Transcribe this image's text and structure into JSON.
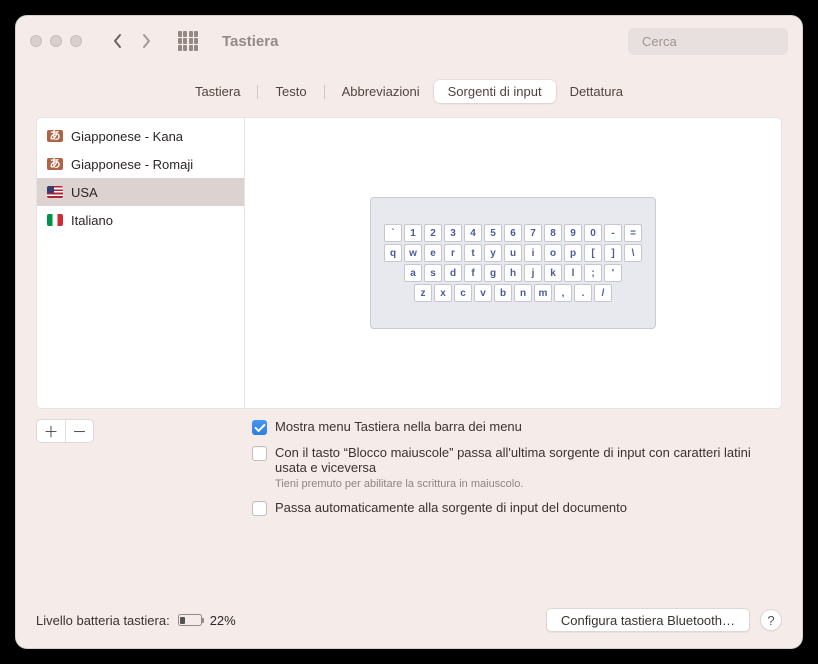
{
  "window": {
    "title": "Tastiera"
  },
  "search": {
    "placeholder": "Cerca"
  },
  "tabs": [
    {
      "label": "Tastiera",
      "selected": false
    },
    {
      "label": "Testo",
      "selected": false
    },
    {
      "label": "Abbreviazioni",
      "selected": false
    },
    {
      "label": "Sorgenti di input",
      "selected": true
    },
    {
      "label": "Dettatura",
      "selected": false
    }
  ],
  "sources": [
    {
      "label": "Giapponese - Kana",
      "flag": "jp",
      "jp_char": "あ",
      "selected": false
    },
    {
      "label": "Giapponese - Romaji",
      "flag": "jp",
      "jp_char": "あ",
      "selected": false
    },
    {
      "label": "USA",
      "flag": "us",
      "selected": true
    },
    {
      "label": "Italiano",
      "flag": "it",
      "selected": false
    }
  ],
  "keyboard_rows": [
    [
      "`",
      "1",
      "2",
      "3",
      "4",
      "5",
      "6",
      "7",
      "8",
      "9",
      "0",
      "-",
      "="
    ],
    [
      "q",
      "w",
      "e",
      "r",
      "t",
      "y",
      "u",
      "i",
      "o",
      "p",
      "[",
      "]",
      "\\"
    ],
    [
      "a",
      "s",
      "d",
      "f",
      "g",
      "h",
      "j",
      "k",
      "l",
      ";",
      "'"
    ],
    [
      "z",
      "x",
      "c",
      "v",
      "b",
      "n",
      "m",
      ",",
      ".",
      "/"
    ]
  ],
  "options": {
    "show_menu": {
      "checked": true,
      "label": "Mostra menu Tastiera nella barra dei menu"
    },
    "caps_switch": {
      "checked": false,
      "label": "Con il tasto “Blocco maiuscole” passa all'ultima sorgente di input con caratteri latini usata e viceversa",
      "hint": "Tieni premuto per abilitare la scrittura in maiuscolo."
    },
    "auto_switch": {
      "checked": false,
      "label": "Passa automaticamente alla sorgente di input del documento"
    }
  },
  "battery": {
    "label": "Livello batteria tastiera:",
    "percent": 22,
    "display": "22%"
  },
  "bluetooth_button": "Configura tastiera Bluetooth…",
  "help_label": "?"
}
